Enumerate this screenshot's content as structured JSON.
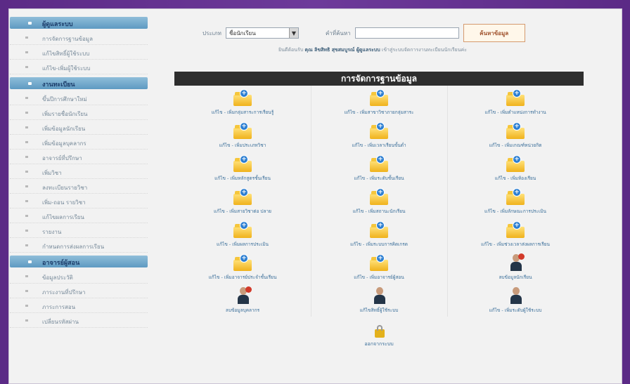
{
  "search": {
    "type_label": "ประเภท",
    "type_value": "ชื่อนักเรียน",
    "keyword_label": "คำที่ค้นหา",
    "keyword_value": "",
    "button_label": "ค้นหาข้อมูล"
  },
  "welcome": {
    "prefix": "ยินดีต้อนรับ",
    "user": "คุณ ลิขสิทธิ สุขสมบูรณ์ ผู้ดูแลระบบ",
    "suffix": "เข้าสู่ระบบจัดการงานทะเบียนนักเรียนค่ะ"
  },
  "sidebar": {
    "sections": [
      {
        "title": "ผู้ดูแลระบบ",
        "items": [
          "การจัดการฐานข้อมูล",
          "แก้ไขสิทธิ์ผู้ใช้ระบบ",
          "แก้ไข-เพิ่มผู้ใช้ระบบ"
        ]
      },
      {
        "title": "งานทะเบียน",
        "items": [
          "ขึ้นปีการศึกษาใหม่",
          "เพิ่มรายชื่อนักเรียน",
          "เพิ่มข้อมูลนักเรียน",
          "เพิ่มข้อมูลบุคลากร",
          "อาจารย์ที่ปรึกษา",
          "เพิ่มวิชา",
          "ลงทะเบียนรายวิชา",
          "เพิ่ม-ถอน รายวิชา",
          "แก้ไขผลการเรียน",
          "รายงาน",
          "กำหนดการส่งผลการเรียน"
        ]
      },
      {
        "title": "อาจารย์ผู้สอน",
        "items": [
          "ข้อมูลประวัติ",
          "ภาระงานที่ปรึกษา",
          "ภาระการสอน",
          "เปลี่ยนรหัสผ่าน"
        ]
      }
    ]
  },
  "panel": {
    "title": "การจัดการฐานข้อมูล",
    "items": [
      {
        "label": "แก้ไข - เพิ่มกลุ่มสาระการเรียนรู้",
        "icon": "folder-add-icon"
      },
      {
        "label": "แก้ไข - เพิ่มสาขาวิชาภายกลุ่มสาระ",
        "icon": "folder-add-icon"
      },
      {
        "label": "แก้ไข - เพิ่มตำแหน่งการทำงาน",
        "icon": "folder-add-icon"
      },
      {
        "label": "แก้ไข - เพิ่มประเภทวิชา",
        "icon": "folder-add-icon"
      },
      {
        "label": "แก้ไข - เพิ่มเวลาเรียนขั้นต่ำ",
        "icon": "folder-add-icon"
      },
      {
        "label": "แก้ไข - เพิ่มเกณฑ์หน่วยกิต",
        "icon": "folder-add-icon"
      },
      {
        "label": "แก้ไข - เพิ่มหลักสูตรชั้นเรียน",
        "icon": "folder-add-icon"
      },
      {
        "label": "แก้ไข - เพิ่มระดับชั้นเรียน",
        "icon": "folder-add-icon"
      },
      {
        "label": "แก้ไข - เพิ่มห้องเรียน",
        "icon": "folder-add-icon"
      },
      {
        "label": "แก้ไข - เพิ่มสายวิชาต่อ ปลาย",
        "icon": "folder-add-icon"
      },
      {
        "label": "แก้ไข - เพิ่มสถานะนักเรียน",
        "icon": "folder-add-icon"
      },
      {
        "label": "แก้ไข - เพิ่มลักษณะการประเมิน",
        "icon": "folder-add-icon"
      },
      {
        "label": "แก้ไข - เพิ่มผลการประเมิน",
        "icon": "folder-add-icon"
      },
      {
        "label": "แก้ไข - เพิ่มระบบการคิดเกรด",
        "icon": "folder-add-icon"
      },
      {
        "label": "แก้ไข - เพิ่มช่วงเวลาส่งผลการเรียน",
        "icon": "folder-add-icon"
      },
      {
        "label": "แก้ไข - เพิ่มอาจารย์ประจำชั้นเรียน",
        "icon": "folder-add-icon"
      },
      {
        "label": "แก้ไข - เพิ่มอาจารย์ผู้สอน",
        "icon": "folder-add-icon"
      },
      {
        "label": "ลบข้อมูลนักเรียน",
        "icon": "user-delete-icon"
      },
      {
        "label": "ลบข้อมูลบุคลากร",
        "icon": "user-delete-icon"
      },
      {
        "label": "แก้ไขสิทธิ์ผู้ใช้ระบบ",
        "icon": "user-icon"
      },
      {
        "label": "แก้ไข - เพิ่มระดับผู้ใช้ระบบ",
        "icon": "user-icon"
      }
    ],
    "logout_label": "ออกจากระบบ"
  }
}
